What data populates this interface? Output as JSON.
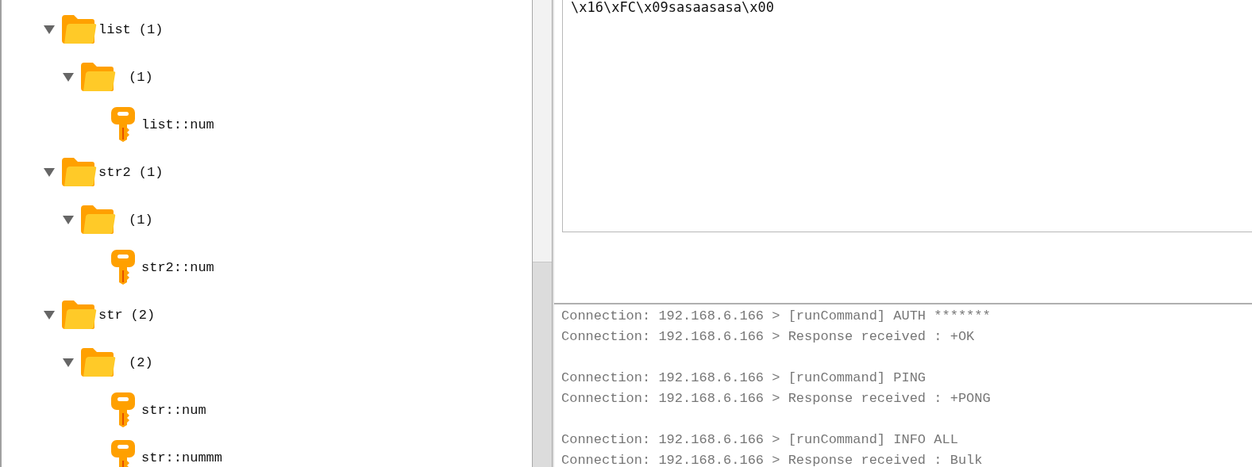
{
  "tree": [
    {
      "kind": "folder",
      "label": "list",
      "count": "(1)",
      "expanded": true,
      "children": [
        {
          "kind": "folder",
          "count": "(1)",
          "expanded": true,
          "children": [
            {
              "kind": "key",
              "label": "list::num"
            }
          ]
        }
      ]
    },
    {
      "kind": "folder",
      "label": "str2",
      "count": "(1)",
      "expanded": true,
      "children": [
        {
          "kind": "folder",
          "count": "(1)",
          "expanded": true,
          "children": [
            {
              "kind": "key",
              "label": "str2::num"
            }
          ]
        }
      ]
    },
    {
      "kind": "folder",
      "label": "str",
      "count": "(2)",
      "expanded": true,
      "children": [
        {
          "kind": "folder",
          "count": "(2)",
          "expanded": true,
          "children": [
            {
              "kind": "key",
              "label": "str::num"
            },
            {
              "kind": "key",
              "label": "str::nummm"
            }
          ]
        }
      ]
    }
  ],
  "value_viewer": {
    "value": "\\x16\\xFC\\x09sasaasasa\\x00"
  },
  "log": [
    [
      "Connection: 192.168.6.166 > [runCommand] AUTH *******",
      "Connection: 192.168.6.166 > Response received : +OK"
    ],
    [
      "Connection: 192.168.6.166 > [runCommand] PING",
      "Connection: 192.168.6.166 > Response received : +PONG"
    ],
    [
      "Connection: 192.168.6.166 > [runCommand] INFO ALL",
      "Connection: 192.168.6.166 > Response received : Bulk"
    ]
  ]
}
